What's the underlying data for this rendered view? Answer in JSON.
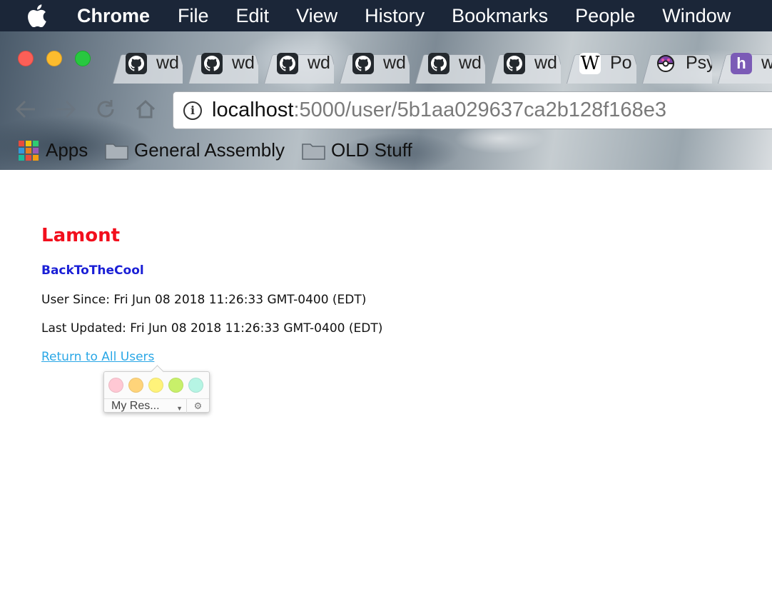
{
  "menubar": {
    "apple_icon": "apple-logo-icon",
    "items": [
      "Chrome",
      "File",
      "Edit",
      "View",
      "History",
      "Bookmarks",
      "People",
      "Window"
    ]
  },
  "tabs": [
    {
      "title": "wd",
      "icon": "github-icon"
    },
    {
      "title": "wd",
      "icon": "github-icon"
    },
    {
      "title": "wd",
      "icon": "github-icon"
    },
    {
      "title": "wd",
      "icon": "github-icon"
    },
    {
      "title": "wd",
      "icon": "github-icon"
    },
    {
      "title": "wd",
      "icon": "github-icon"
    },
    {
      "title": "Po",
      "icon": "wikipedia-icon",
      "icon_text": "W"
    },
    {
      "title": "Psy",
      "icon": "pokeball-icon"
    },
    {
      "title": "w",
      "icon": "heroku-icon",
      "icon_text": "h"
    }
  ],
  "omnibox": {
    "url_host": "localhost",
    "url_rest": ":5000/user/5b1aa029637ca2b128f168e3"
  },
  "bookmarks": {
    "apps": "Apps",
    "folder1": "General Assembly",
    "folder2": "OLD Stuff"
  },
  "profile": {
    "name": "Lamont",
    "handle": "BackToTheCool",
    "user_since": "User Since: Fri Jun 08 2018 11:26:33 GMT-0400 (EDT)",
    "last_updated": "Last Updated: Fri Jun 08 2018 11:26:33 GMT-0400 (EDT)",
    "return_link": "Return to All Users"
  },
  "colors": {
    "name": "#f20f1d",
    "handle": "#1a1fd6",
    "link": "#2aa7e6"
  },
  "popup": {
    "swatches": [
      "#ffc8d4",
      "#ffd47a",
      "#fff37a",
      "#c8f06a",
      "#b6f5e4"
    ],
    "select_label": "My Res...",
    "settings_icon": "gear-icon"
  }
}
